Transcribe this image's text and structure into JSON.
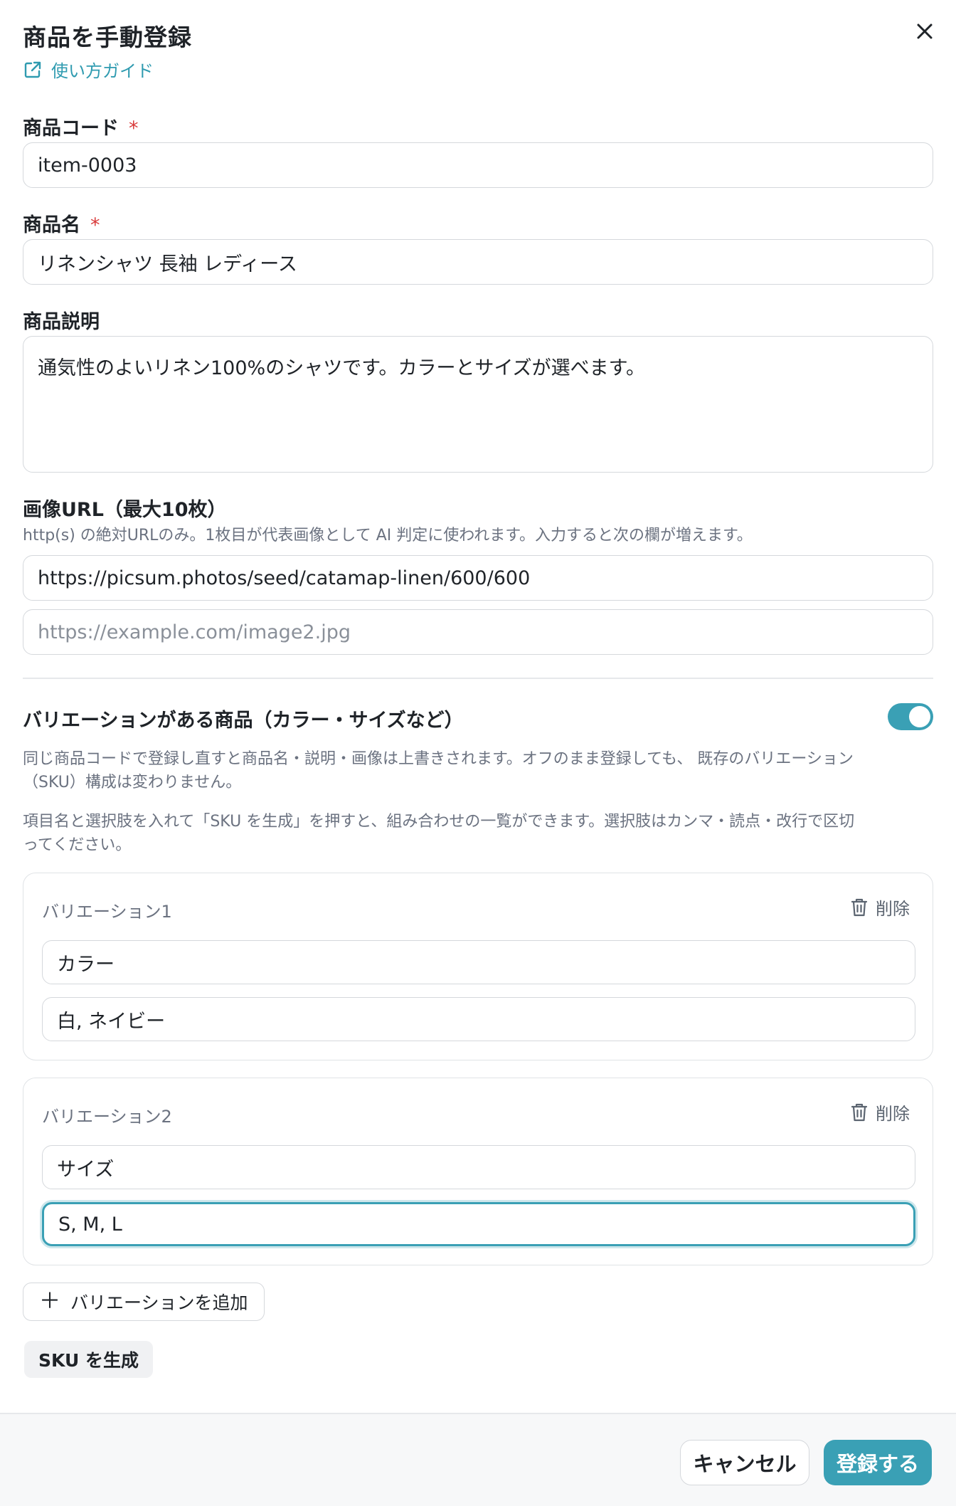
{
  "modal": {
    "title": "商品を手動登録",
    "guide_link": "使い方ガイド"
  },
  "fields": {
    "product_code": {
      "label": "商品コード",
      "required_mark": "*",
      "value": "item-0003"
    },
    "product_name": {
      "label": "商品名",
      "required_mark": "*",
      "value": "リネンシャツ 長袖 レディース"
    },
    "description": {
      "label": "商品説明",
      "value": "通気性のよいリネン100%のシャツです。カラーとサイズが選べます。"
    },
    "images": {
      "label": "画像URL（最大10枚）",
      "hint": "http(s) の絶対URLのみ。1枚目が代表画像として AI 判定に使われます。入力すると次の欄が増えます。",
      "url1": "https://picsum.photos/seed/catamap-linen/600/600",
      "url2_placeholder": "https://example.com/image2.jpg"
    }
  },
  "variations": {
    "section_title": "バリエーションがある商品（カラー・サイズなど）",
    "toggle_on": true,
    "note1_line1": "同じ商品コードで登録し直すと商品名・説明・画像は上書きされます。オフのまま登録しても、 既存のバリエーション",
    "note1_line2": "（SKU）構成は変わりません。",
    "note2_line1": "項目名と選択肢を入れて「SKU を生成」を押すと、組み合わせの一覧ができます。選択肢はカンマ・読点・改行で区切",
    "note2_line2": "ってください。",
    "items": [
      {
        "title": "バリエーション1",
        "delete_label": "削除",
        "name": "カラー",
        "options": "白, ネイビー"
      },
      {
        "title": "バリエーション2",
        "delete_label": "削除",
        "name": "サイズ",
        "options": "S, M, L"
      }
    ],
    "add_button": "バリエーションを追加",
    "add_button_plus": "＋",
    "generate_sku_button": "SKU を生成"
  },
  "footer": {
    "cancel": "キャンセル",
    "submit": "登録する"
  },
  "colors": {
    "accent": "#3aa0b5",
    "required": "#d93b3b"
  }
}
